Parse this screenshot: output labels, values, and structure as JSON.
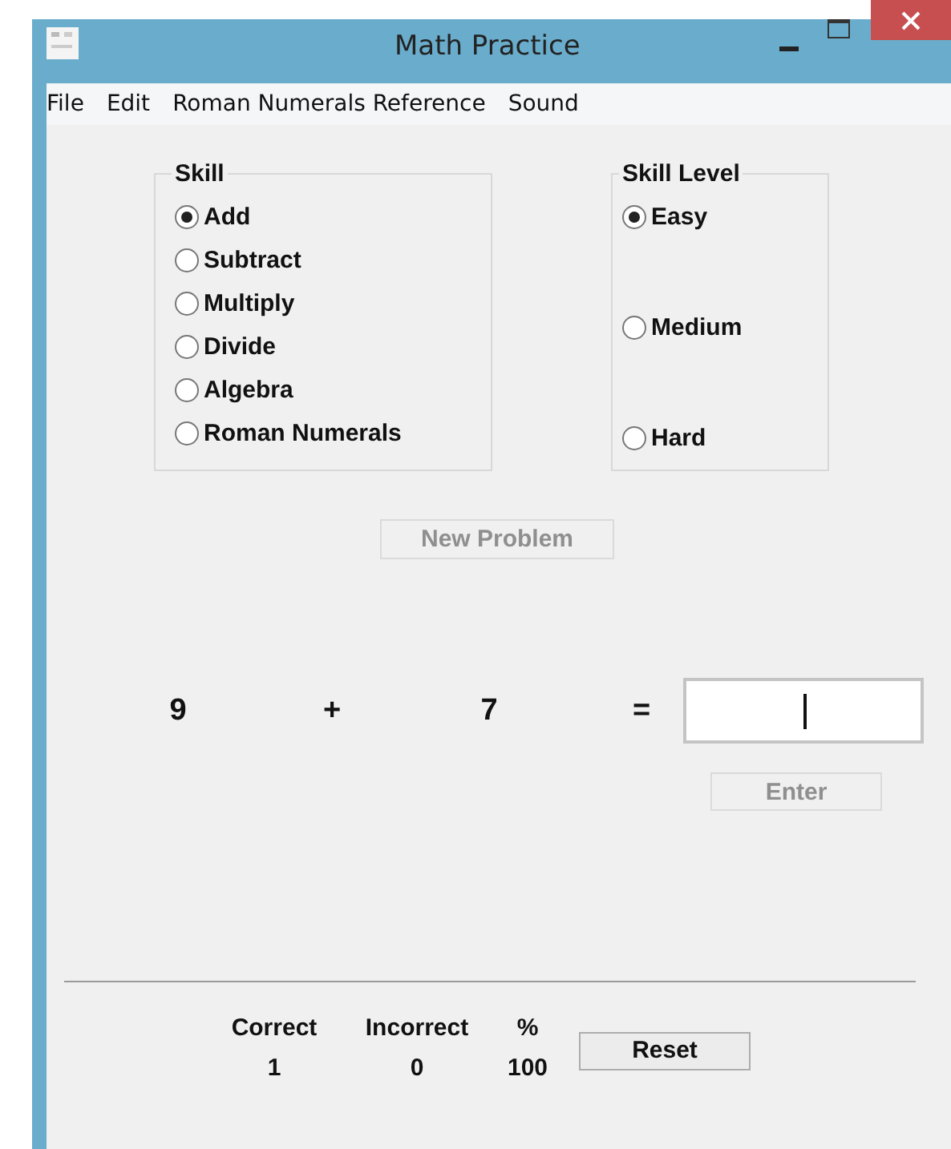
{
  "window": {
    "title": "Math Practice"
  },
  "menu": [
    {
      "label": "File"
    },
    {
      "label": "Edit"
    },
    {
      "label": "Roman Numerals Reference"
    },
    {
      "label": "Sound"
    }
  ],
  "skill": {
    "title": "Skill",
    "options": [
      {
        "label": "Add",
        "selected": true
      },
      {
        "label": "Subtract",
        "selected": false
      },
      {
        "label": "Multiply",
        "selected": false
      },
      {
        "label": "Divide",
        "selected": false
      },
      {
        "label": "Algebra",
        "selected": false
      },
      {
        "label": "Roman Numerals",
        "selected": false
      }
    ]
  },
  "skill_level": {
    "title": "Skill Level",
    "options": [
      {
        "label": "Easy",
        "selected": true
      },
      {
        "label": "Medium",
        "selected": false
      },
      {
        "label": "Hard",
        "selected": false
      }
    ]
  },
  "new_problem_button": {
    "label": "New Problem",
    "disabled": true
  },
  "equation": {
    "operand_1": "9",
    "operator": "+",
    "operand_2": "7",
    "equals": "="
  },
  "enter_button": {
    "label": "Enter",
    "disabled": true
  },
  "stats": [
    {
      "label": "Correct",
      "value": "1"
    },
    {
      "label": "Incorrect",
      "value": "0"
    },
    {
      "label": "%",
      "value": "100"
    }
  ],
  "reset_button": {
    "label": "Reset",
    "disabled": false
  }
}
